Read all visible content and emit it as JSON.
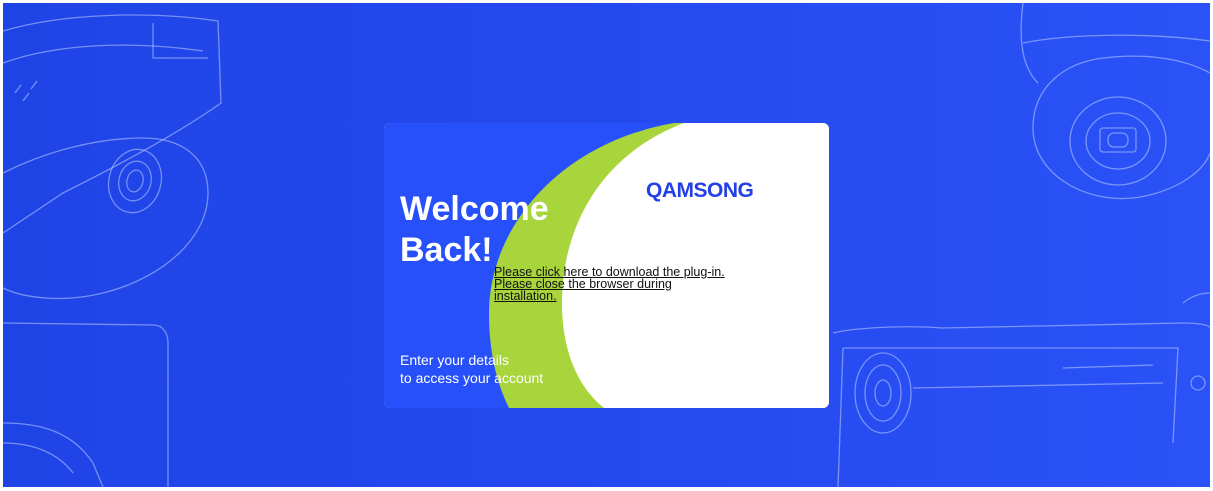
{
  "colors": {
    "page_background": "#2448ee",
    "card_blue": "#2850fa",
    "accent_green": "#a8d43c",
    "brand_blue": "#2340e8"
  },
  "background": {
    "decoration_icons": [
      "dome-camera-icon",
      "turret-camera-icon",
      "bullet-camera-icon"
    ]
  },
  "card": {
    "welcome_title": "Welcome\nBack!",
    "plugin_link": "Please click here to download the plug-in. Please close the browser during installation.",
    "tagline": "Enter your details\nto access your account",
    "logo_text": "QAMSONG"
  }
}
